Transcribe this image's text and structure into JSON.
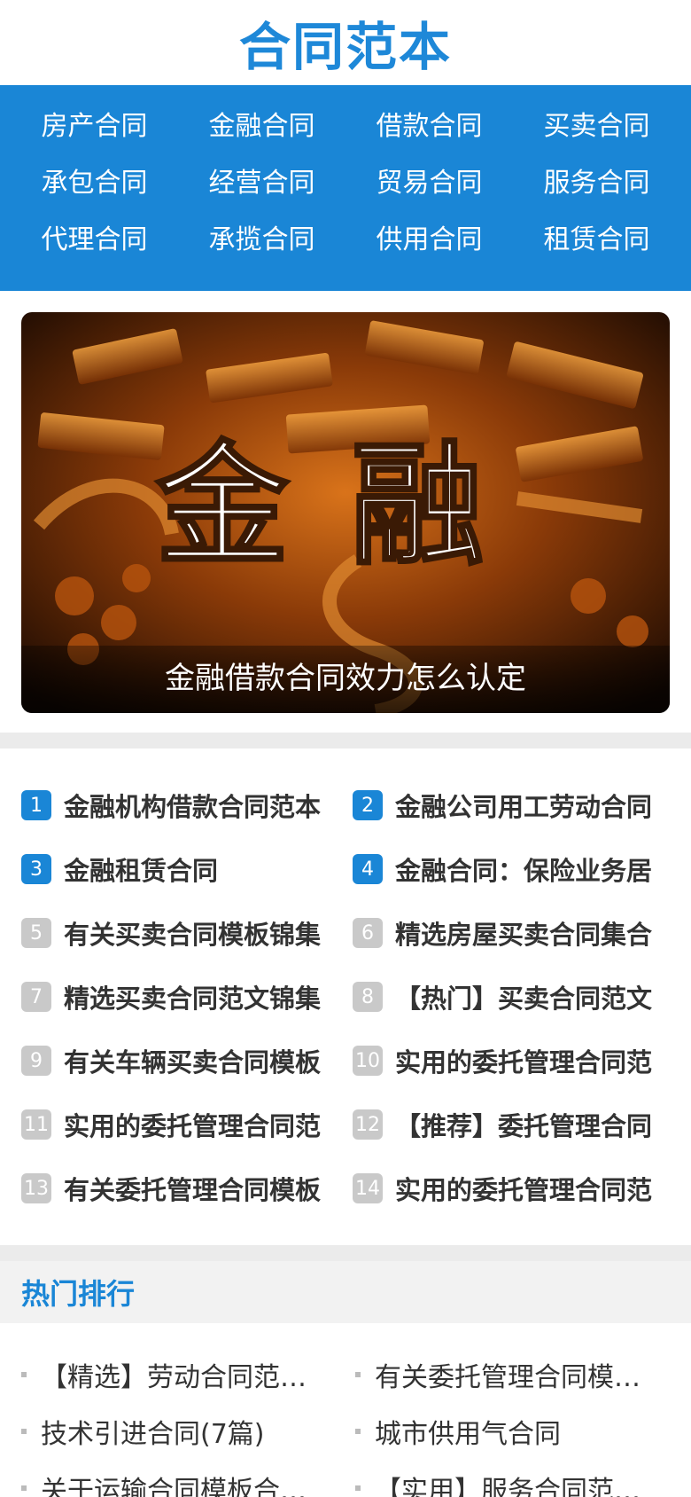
{
  "site": {
    "title": "合同范本"
  },
  "nav": {
    "items": [
      {
        "label": "房产合同"
      },
      {
        "label": "金融合同"
      },
      {
        "label": "借款合同"
      },
      {
        "label": "买卖合同"
      },
      {
        "label": "承包合同"
      },
      {
        "label": "经营合同"
      },
      {
        "label": "贸易合同"
      },
      {
        "label": "服务合同"
      },
      {
        "label": "代理合同"
      },
      {
        "label": "承揽合同"
      },
      {
        "label": "供用合同"
      },
      {
        "label": "租赁合同"
      }
    ]
  },
  "banner": {
    "caption": "金融借款合同效力怎么认定",
    "image_text": "金融"
  },
  "numbered_list": [
    {
      "num": "1",
      "title": "金融机构借款合同范本"
    },
    {
      "num": "2",
      "title": "金融公司用工劳动合同"
    },
    {
      "num": "3",
      "title": "金融租赁合同"
    },
    {
      "num": "4",
      "title": "金融合同：保险业务居"
    },
    {
      "num": "5",
      "title": "有关买卖合同模板锦集"
    },
    {
      "num": "6",
      "title": "精选房屋买卖合同集合"
    },
    {
      "num": "7",
      "title": "精选买卖合同范文锦集"
    },
    {
      "num": "8",
      "title": "【热门】买卖合同范文"
    },
    {
      "num": "9",
      "title": "有关车辆买卖合同模板"
    },
    {
      "num": "10",
      "title": "实用的委托管理合同范"
    },
    {
      "num": "11",
      "title": "实用的委托管理合同范"
    },
    {
      "num": "12",
      "title": "【推荐】委托管理合同"
    },
    {
      "num": "13",
      "title": "有关委托管理合同模板"
    },
    {
      "num": "14",
      "title": "实用的委托管理合同范"
    }
  ],
  "hot": {
    "title": "热门排行",
    "items": [
      {
        "title": "【精选】劳动合同范…"
      },
      {
        "title": "有关委托管理合同模…"
      },
      {
        "title": "技术引进合同(7篇)"
      },
      {
        "title": "城市供用气合同"
      },
      {
        "title": "关于运输合同模板合…"
      },
      {
        "title": "【实用】服务合同范…"
      }
    ]
  },
  "colors": {
    "accent": "#1a86d6",
    "badge_inactive": "#c9c9c9"
  }
}
